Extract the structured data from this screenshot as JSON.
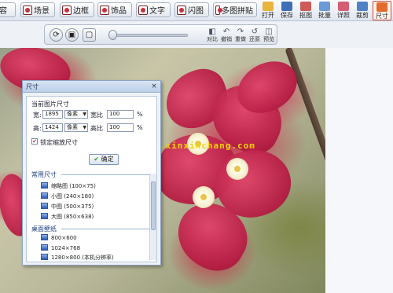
{
  "toolbar": {
    "buttons": [
      {
        "label": "容"
      },
      {
        "label": "场景"
      },
      {
        "label": "边框"
      },
      {
        "label": "饰品"
      },
      {
        "label": "文字"
      },
      {
        "label": "闪图"
      },
      {
        "label": "多图拼贴"
      }
    ],
    "side_buttons": [
      {
        "label": "打开"
      },
      {
        "label": "保存"
      },
      {
        "label": "抠图"
      },
      {
        "label": "批量"
      },
      {
        "label": "详照"
      },
      {
        "label": "裁剪"
      },
      {
        "label": "尺寸"
      }
    ]
  },
  "subbar": {
    "tools": [
      {
        "label": "对比"
      },
      {
        "label": "撤销"
      },
      {
        "label": "重做"
      },
      {
        "label": "还原"
      },
      {
        "label": "预览"
      }
    ]
  },
  "watermark": "www.xinxinchang.com",
  "dialog": {
    "title": "尺寸",
    "close": "×",
    "current_size_label": "当前图片尺寸",
    "width_label": "宽:",
    "width_value": "1895",
    "width_unit": "像素",
    "width_ratio_label": "宽比",
    "width_ratio_value": "100",
    "height_label": "高:",
    "height_value": "1424",
    "height_unit": "像素",
    "height_ratio_label": "高比",
    "height_ratio_value": "100",
    "percent": "%",
    "lock_ratio_label": "锁定缩放尺寸",
    "ok_label": "确定",
    "common_sizes_heading": "常用尺寸",
    "common_sizes": [
      "缩略图 (100×75)",
      "小图 (240×180)",
      "中图 (500×375)",
      "大图 (850×638)"
    ],
    "wallpaper_heading": "桌面壁纸",
    "wallpapers": [
      "800×600",
      "1024×768",
      "1280×800 (本机分辨率)"
    ]
  }
}
